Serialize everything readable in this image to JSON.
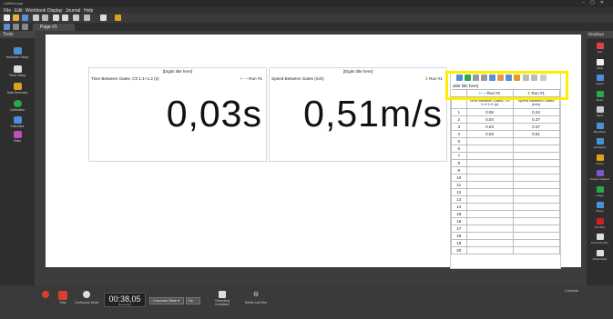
{
  "app": {
    "title": "Untitled.cap"
  },
  "menu": [
    "File",
    "Edit",
    "Workbook",
    "Display",
    "Journal",
    "Help"
  ],
  "page_tab": {
    "label": "Page #1"
  },
  "tools_panel": {
    "title": "Tools",
    "items": [
      {
        "label": "Hardware Setup",
        "icon": "hardware-setup-icon",
        "color": "#4a90d9"
      },
      {
        "label": "Timer Setup",
        "icon": "timer-setup-icon",
        "color": "#dddddd"
      },
      {
        "label": "Data Summary",
        "icon": "data-summary-icon",
        "color": "#e0a21a"
      },
      {
        "label": "Calibration",
        "icon": "calibration-icon",
        "color": "#2ba84a"
      },
      {
        "label": "Calculator",
        "icon": "calculator-icon",
        "color": "#4a90d9"
      },
      {
        "label": "Video",
        "icon": "video-icon",
        "color": "#c44fb8"
      }
    ]
  },
  "displays_panel": {
    "title": "Displays",
    "items": [
      {
        "label": "Text",
        "icon": "text-icon",
        "color": "#e04040"
      },
      {
        "label": "Table",
        "icon": "table-icon",
        "color": "#eeeeee"
      },
      {
        "label": "Graph",
        "icon": "graph-icon",
        "color": "#4a90d9"
      },
      {
        "label": "Meter",
        "icon": "meter-icon",
        "color": "#2ba84a"
      },
      {
        "label": "Digits",
        "icon": "digits-icon",
        "color": "#cccccc"
      },
      {
        "label": "Bar Meter",
        "icon": "bar-meter-icon",
        "color": "#4a90d9"
      },
      {
        "label": "Histogram",
        "icon": "histogram-icon",
        "color": "#4a90d9"
      },
      {
        "label": "Vector",
        "icon": "vector-icon",
        "color": "#e0a21a"
      },
      {
        "label": "Fourier Analysis",
        "icon": "fourier-icon",
        "color": "#7a55cc"
      },
      {
        "label": "Image",
        "icon": "image-icon",
        "color": "#2ba84a"
      },
      {
        "label": "Movie",
        "icon": "movie-icon",
        "color": "#4a90d9"
      },
      {
        "label": "Text Box",
        "icon": "text-box-icon",
        "color": "#cc2222"
      },
      {
        "label": "Text Entry Box",
        "icon": "text-entry-icon",
        "color": "#dddddd"
      },
      {
        "label": "Placeholder",
        "icon": "placeholder-icon",
        "color": "#dddddd"
      }
    ]
  },
  "digits1": {
    "title": "[Digits title here]",
    "measure": "Time Between Gates, Ch 1:1+1:2 (s)",
    "run": "Run #1",
    "value": "0,03s",
    "run_color": "#2f9de0"
  },
  "digits2": {
    "title": "[Digits title here]",
    "measure": "Speed Between Gates (m/s)",
    "run": "Run #1",
    "value": "0,51m/s",
    "run_color": "#e09a20"
  },
  "table": {
    "title": "able title here]",
    "run1": "Run #1",
    "run2": "Run #1",
    "col1": "Time Between Gates, Ch 1:1+1:2 (s)",
    "col2": "Speed Between Gates (m/s)",
    "rows": [
      [
        "1",
        "0.06",
        "0.24"
      ],
      [
        "2",
        "0.04",
        "0.37"
      ],
      [
        "3",
        "0.04",
        "0.37"
      ],
      [
        "4",
        "0.03",
        "0.51"
      ],
      [
        "5",
        "",
        ""
      ],
      [
        "6",
        "",
        ""
      ],
      [
        "7",
        "",
        ""
      ],
      [
        "8",
        "",
        ""
      ],
      [
        "9",
        "",
        ""
      ],
      [
        "10",
        "",
        ""
      ],
      [
        "11",
        "",
        ""
      ],
      [
        "12",
        "",
        ""
      ],
      [
        "13",
        "",
        ""
      ],
      [
        "14",
        "",
        ""
      ],
      [
        "15",
        "",
        ""
      ],
      [
        "16",
        "",
        ""
      ],
      [
        "17",
        "",
        ""
      ],
      [
        "18",
        "",
        ""
      ],
      [
        "19",
        "",
        ""
      ],
      [
        "20",
        "",
        ""
      ]
    ]
  },
  "bottom": {
    "stop_label": "Stop",
    "mode_label": "Continuous Mode",
    "timer_value": "00:38,05",
    "timer_sub": "Recording",
    "comment_label": "Common Rate",
    "rate_value": "Hz",
    "recording_label": "Recording Conditions",
    "delete_label": "Delete Last Run",
    "controls_label": "Controls"
  },
  "colors": {
    "highlight": "#ffee00",
    "record": "#d9402b"
  }
}
